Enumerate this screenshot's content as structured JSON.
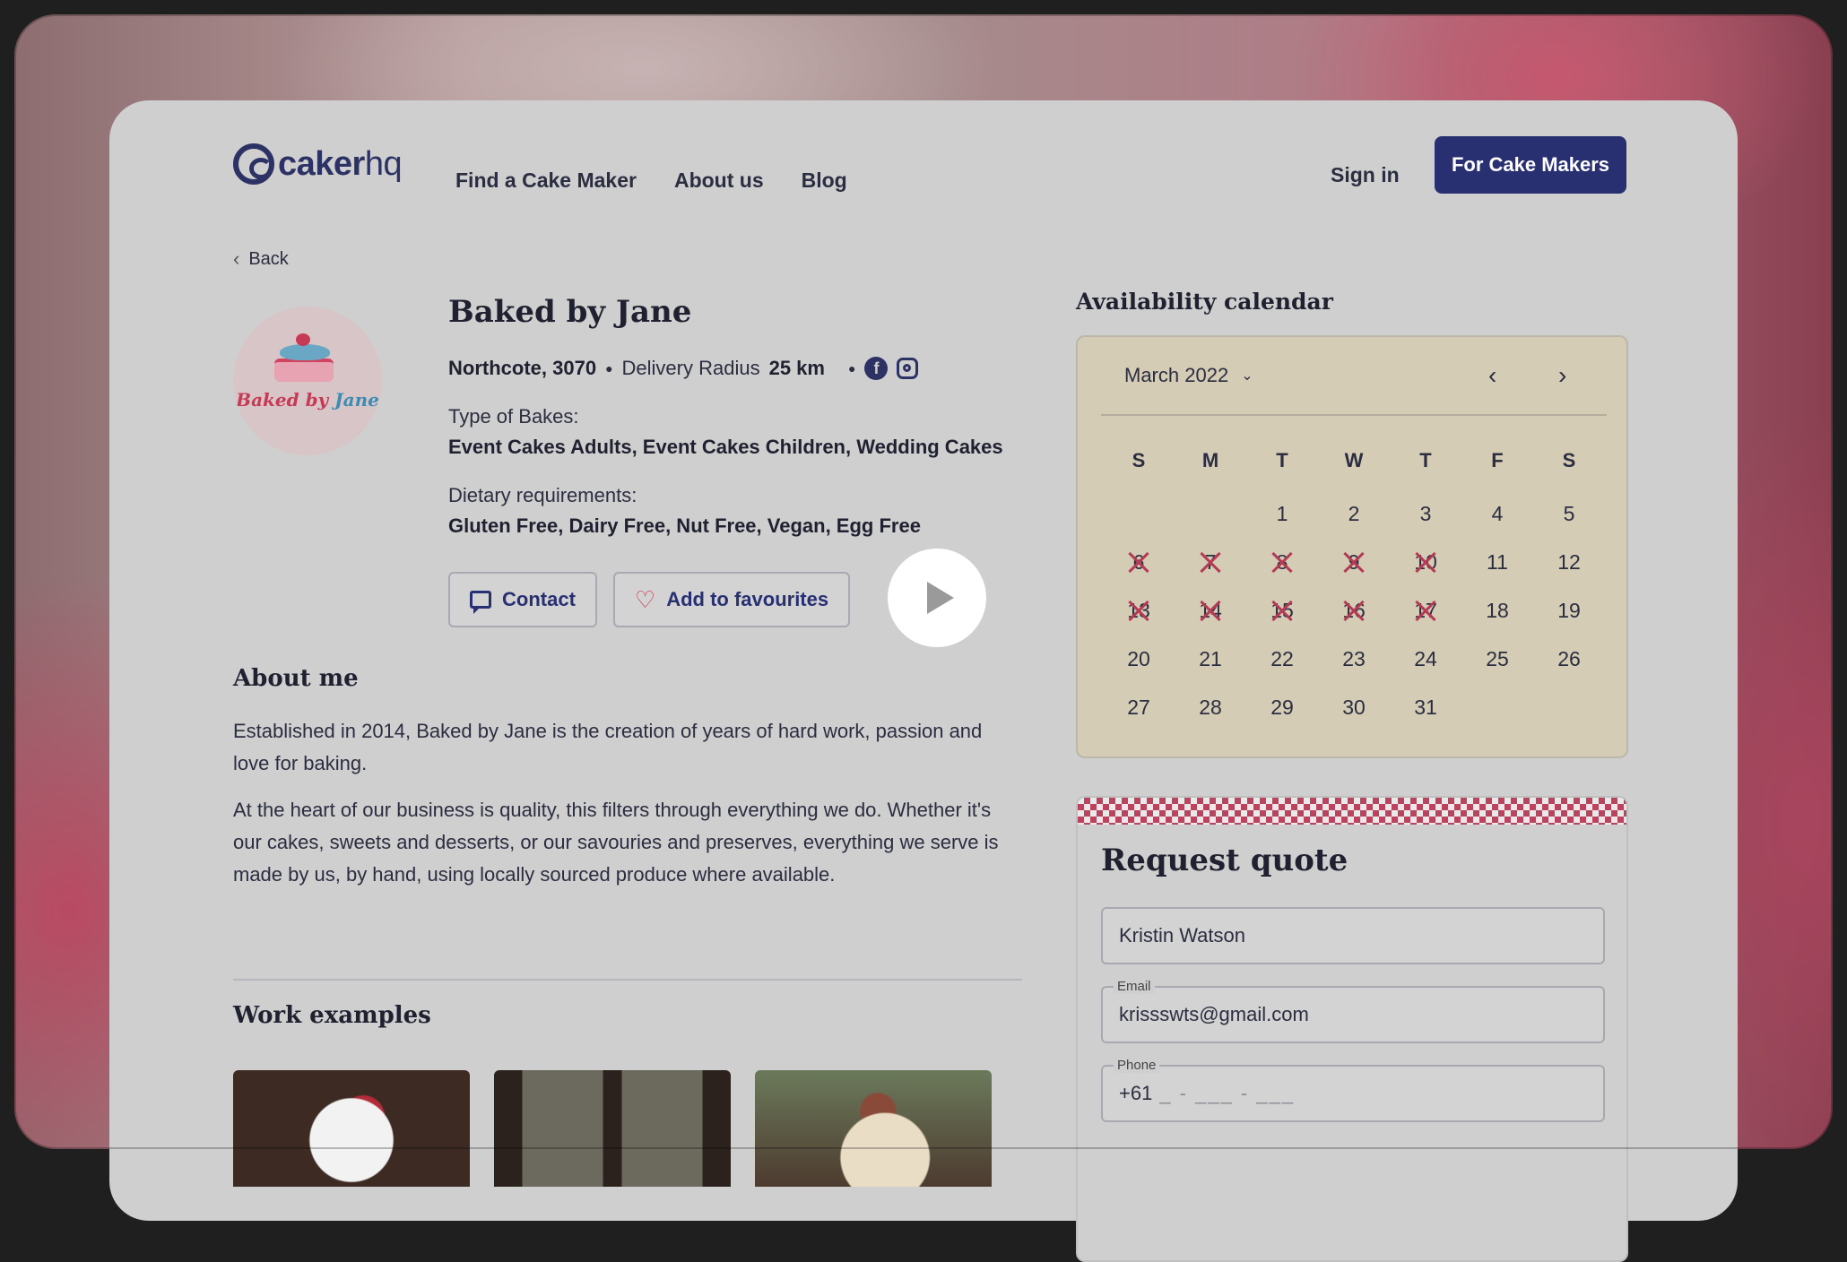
{
  "brand": {
    "name_main": "caker",
    "name_suffix": "hq"
  },
  "nav": {
    "items": [
      "Find a Cake Maker",
      "About us",
      "Blog"
    ],
    "sign_in": "Sign in",
    "cta": "For Cake Makers"
  },
  "back_label": "Back",
  "profile": {
    "avatar_text_1": "Baked by",
    "avatar_text_2": "Jane",
    "name": "Baked by Jane",
    "location": "Northcote, 3070",
    "delivery_label": "Delivery Radius",
    "delivery_value": "25 km",
    "bakes_label": "Type of Bakes:",
    "bakes_value": "Event Cakes Adults, Event Cakes Children, Wedding Cakes",
    "dietary_label": "Dietary requirements:",
    "dietary_value": "Gluten Free, Dairy Free, Nut Free, Vegan, Egg Free",
    "contact_label": "Contact",
    "favourites_label": "Add to favourites"
  },
  "about": {
    "heading": "About me",
    "p1": "Established in 2014, Baked by Jane is the creation of years of hard work, passion and love for baking.",
    "p2": "At the heart of our business is quality, this filters through everything we do. Whether it's our cakes, sweets and desserts, or our savouries and preserves, everything we serve is made by us, by hand, using locally sourced produce where available."
  },
  "work_heading": "Work examples",
  "calendar": {
    "title": "Availability calendar",
    "month": "March 2022",
    "days_of_week": [
      "S",
      "M",
      "T",
      "W",
      "T",
      "F",
      "S"
    ],
    "leading_blanks": 2,
    "days_in_month": 31,
    "unavailable": [
      6,
      7,
      8,
      9,
      10,
      13,
      14,
      15,
      16,
      17
    ]
  },
  "quote": {
    "title": "Request quote",
    "name_value": "Kristin Watson",
    "email_label": "Email",
    "email_value": "krissswts@gmail.com",
    "phone_label": "Phone",
    "phone_prefix": "+61",
    "phone_mask": "_ - ___ - ___"
  },
  "colors": {
    "brand_navy": "#283072",
    "accent_red": "#c73a56",
    "calendar_bg": "#d5ccb6"
  }
}
